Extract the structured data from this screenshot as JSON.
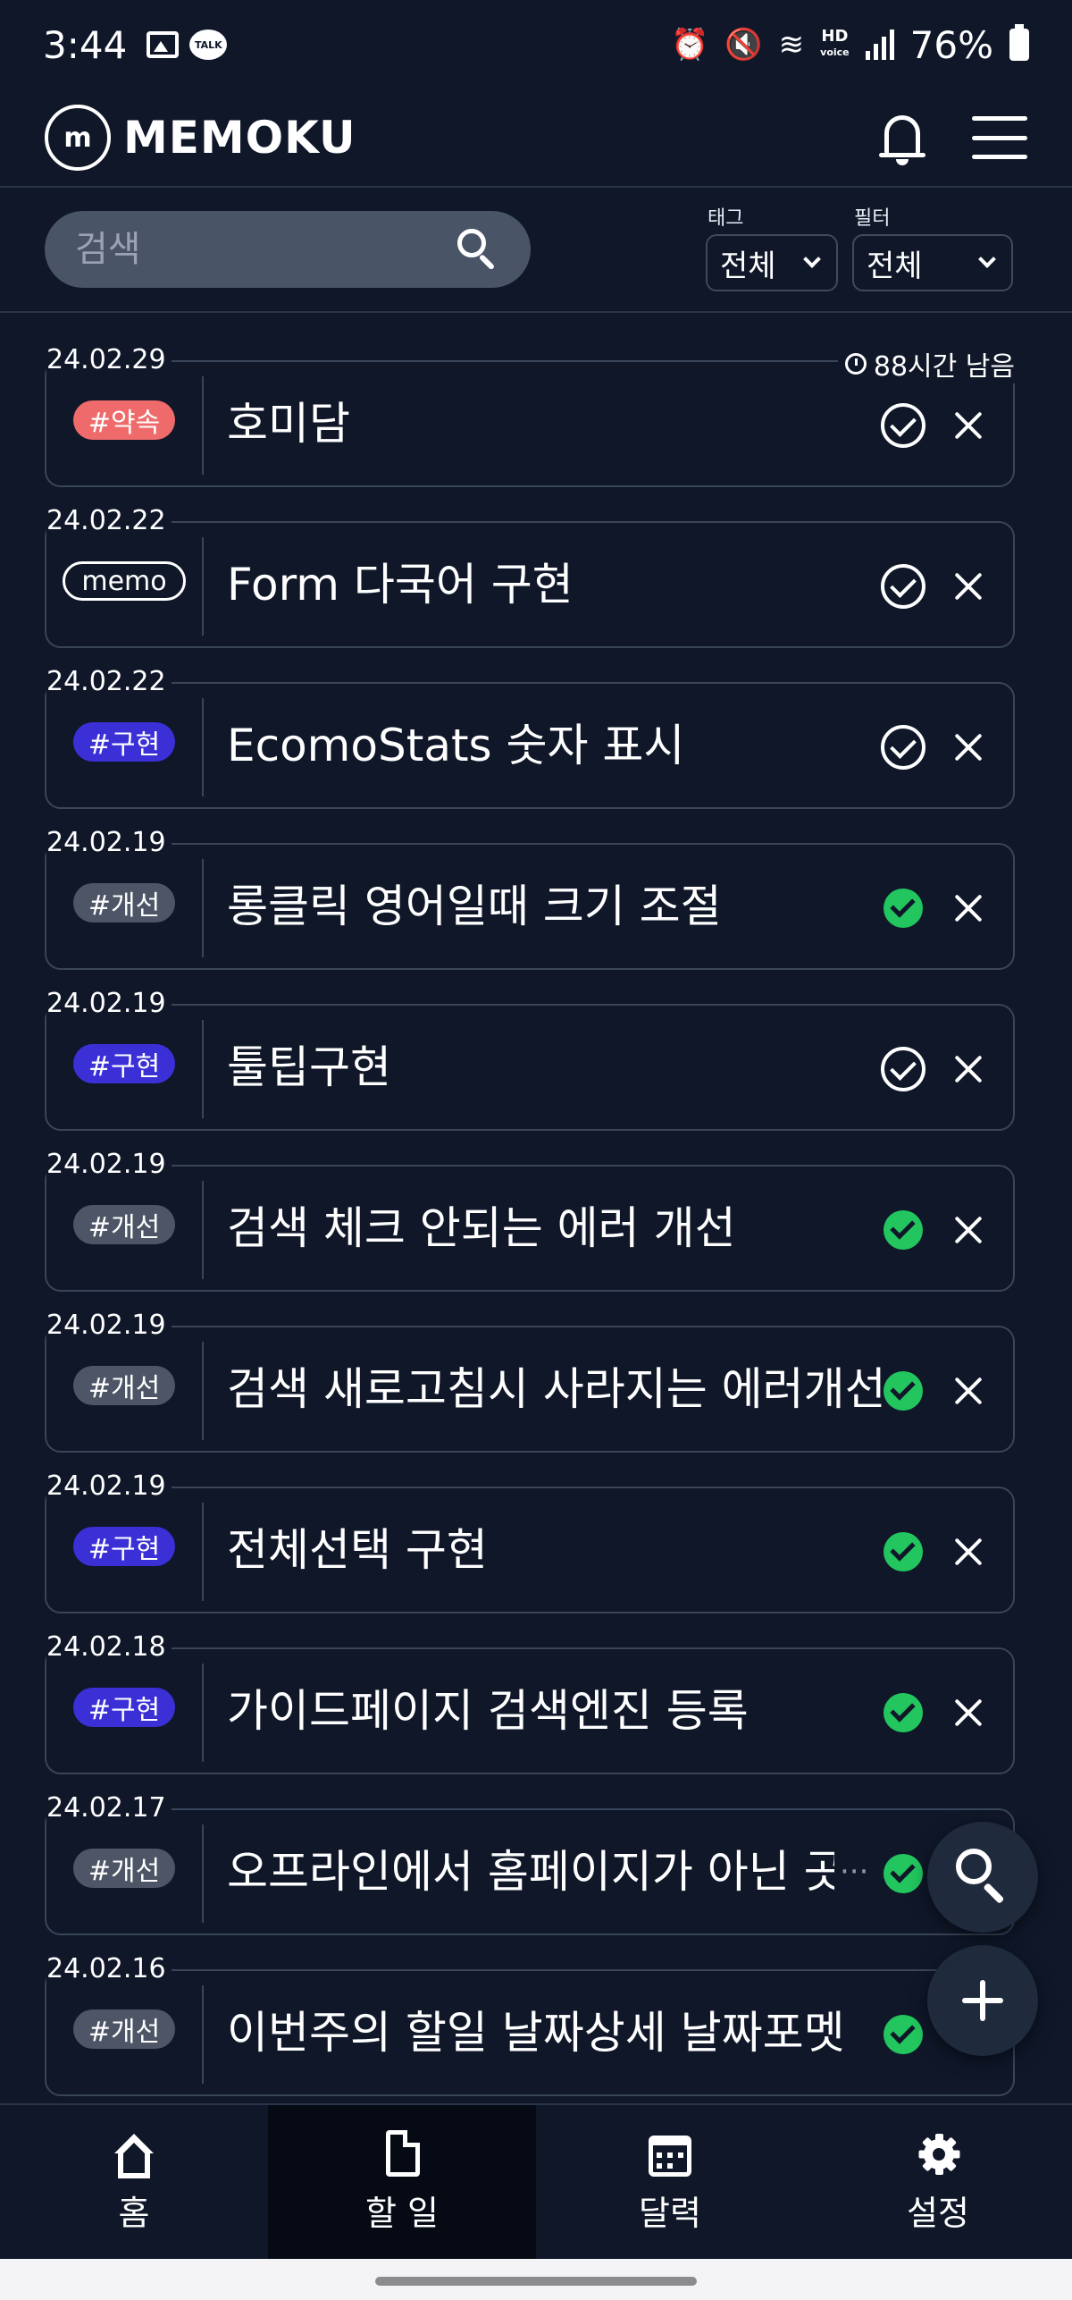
{
  "status_bar": {
    "time": "3:44",
    "talk_badge": "TALK",
    "hd_label": "HD",
    "voice_label": "voice",
    "battery": "76%",
    "icons": [
      "image-icon",
      "kakaotalk-icon",
      "alarm-icon",
      "mute-icon",
      "wifi-icon",
      "signal-icon",
      "battery-icon"
    ]
  },
  "app": {
    "logo_letter": "m",
    "name": "MEMOKU"
  },
  "search": {
    "placeholder": "검색"
  },
  "tag_select": {
    "label": "태그",
    "value": "전체"
  },
  "filter_select": {
    "label": "필터",
    "value": "전체"
  },
  "colors": {
    "background": "#0f1729",
    "tag_red": "#ef6b6b",
    "tag_blue": "#3b30d6",
    "tag_gray": "#4d5566",
    "done_green": "#22c55e"
  },
  "todos": [
    {
      "date": "24.02.29",
      "remaining": "88시간 남음",
      "tag": "#약속",
      "tag_style": "red",
      "title": "호미담",
      "done": false
    },
    {
      "date": "24.02.22",
      "tag": "memo",
      "tag_style": "outline",
      "title": "Form 다국어 구현",
      "done": false
    },
    {
      "date": "24.02.22",
      "tag": "#구현",
      "tag_style": "blue",
      "title": "EcomoStats 숫자 표시",
      "done": false
    },
    {
      "date": "24.02.19",
      "tag": "#개선",
      "tag_style": "gray",
      "title": "롱클릭 영어일때 크기 조절",
      "done": true
    },
    {
      "date": "24.02.19",
      "tag": "#구현",
      "tag_style": "blue",
      "title": "툴팁구현",
      "done": false
    },
    {
      "date": "24.02.19",
      "tag": "#개선",
      "tag_style": "gray",
      "title": "검색 체크 안되는 에러 개선",
      "done": true
    },
    {
      "date": "24.02.19",
      "tag": "#개선",
      "tag_style": "gray",
      "title": "검색 새로고침시 사라지는 에러개선",
      "done": true
    },
    {
      "date": "24.02.19",
      "tag": "#구현",
      "tag_style": "blue",
      "title": "전체선택 구현",
      "done": true
    },
    {
      "date": "24.02.18",
      "tag": "#구현",
      "tag_style": "blue",
      "title": "가이드페이지 검색엔진 등록",
      "done": true
    },
    {
      "date": "24.02.17",
      "tag": "#개선",
      "tag_style": "gray",
      "title": "오프라인에서 홈페이지가 아닌 곳",
      "done": true,
      "truncated": "···"
    },
    {
      "date": "24.02.16",
      "tag": "#개선",
      "tag_style": "gray",
      "title": "이번주의 할일 날짜상세 날짜포멧",
      "done": true
    }
  ],
  "bottom_nav": [
    {
      "label": "홈",
      "icon": "home-icon",
      "active": false
    },
    {
      "label": "할 일",
      "icon": "document-icon",
      "active": true
    },
    {
      "label": "달력",
      "icon": "calendar-icon",
      "active": false
    },
    {
      "label": "설정",
      "icon": "settings-icon",
      "active": false
    }
  ]
}
